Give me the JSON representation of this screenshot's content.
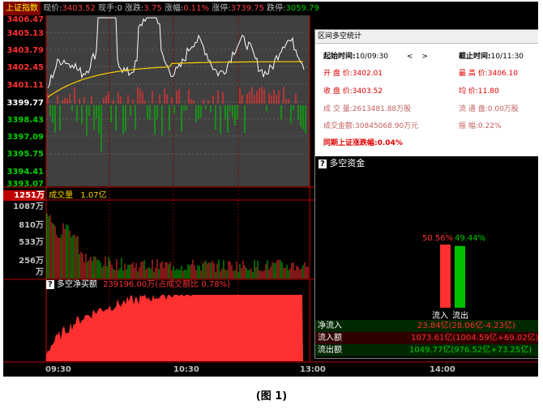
{
  "topbar": {
    "index_name": "上证指数",
    "price_label": "现价:",
    "price": "3403.52",
    "hand_label": "现手:",
    "hand": "0",
    "change_label": "涨跌:",
    "change": "3.75",
    "pct_label": "涨幅:",
    "pct": "0.11%",
    "limit_up_label": "涨停:",
    "limit_up": "3739.75",
    "limit_down_label": "跌停:",
    "limit_down": "3059.79"
  },
  "price_axis": [
    "3406.47",
    "3405.13",
    "3403.79",
    "3402.45",
    "3401.11",
    "3399.77",
    "3398.43",
    "3397.09",
    "3395.75",
    "3394.41",
    "3393.07"
  ],
  "volume_panel": {
    "label": "成交量",
    "value": "1.07亿",
    "axis": [
      "1251万",
      "1087万",
      "810万",
      "533万",
      "256万",
      "万"
    ]
  },
  "net_buy_panel": {
    "icon_label": "?",
    "label": "多空净买额",
    "value": "239196.00万(占成交额比 0.78%)"
  },
  "time_axis": [
    "09:30",
    "10:30",
    "13:00",
    "14:00"
  ],
  "dialog": {
    "title": "区间多空统计",
    "start_label": "起始时间:",
    "start_value": "10/09:30",
    "end_label": "截止时间:",
    "end_value": "10/11:30",
    "prev": "<",
    "next": ">",
    "open_label": "开 盘 价:",
    "open_value": "3402.01",
    "high_label": "最 高 价:",
    "high_value": "3406.10",
    "close_label": "收 盘 价:",
    "close_value": "3403.52",
    "avg_label": "均    价:",
    "avg_value": "11.80",
    "vol_label": "成 交 量:",
    "vol_value": "2613481.88万股",
    "float_label": "流 通 盘:",
    "float_value": "0.00万股",
    "amount_label": "成交金额:",
    "amount_value": "30845068.90万元",
    "amp_label": "振    幅:",
    "amp_value": "0.22%",
    "sync_label": "同期上证涨跌幅:",
    "sync_value": "0.04%"
  },
  "duokong": {
    "icon_label": "?",
    "title": "多空资金",
    "inflow_pct": "50.56%",
    "outflow_pct": "49.44%",
    "inflow_share": 0.5056,
    "outflow_share": 0.4944,
    "inflow_axis_label": "流入",
    "outflow_axis_label": "流出",
    "net_label": "净流入",
    "net_value": "23.84亿(28.06亿-4.23亿)",
    "in_label": "流入额",
    "in_value": "1073.61亿(1004.59亿+69.02亿)",
    "out_label": "流出额",
    "out_value": "1049.77亿(976.52亿+73.25亿)"
  },
  "caption": "(图 1)",
  "colors": {
    "up": "#ff3030",
    "down": "#00c000",
    "avg_line": "#ffd000",
    "price_line": "#ffffff",
    "grid": "#800000"
  }
}
